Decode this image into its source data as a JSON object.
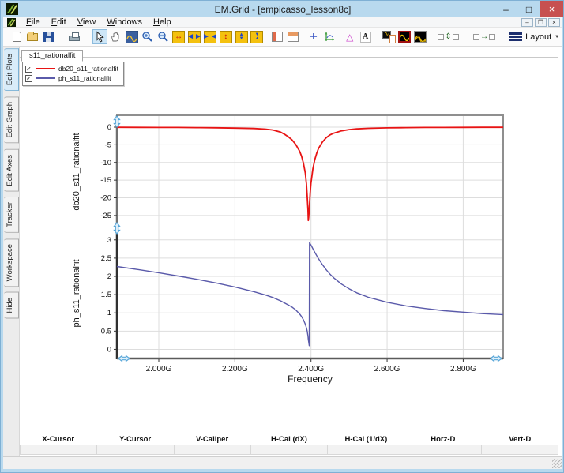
{
  "window": {
    "title": "EM.Grid - [empicasso_lesson8c]",
    "controls": {
      "minimize": "–",
      "maximize": "□",
      "close": "×",
      "mdi_minimize": "–",
      "mdi_restore": "❐",
      "mdi_close": "×"
    }
  },
  "menu": {
    "items": [
      "File",
      "Edit",
      "View",
      "Windows",
      "Help"
    ]
  },
  "toolbar": {
    "layout_label": "Layout",
    "text_tool_label": "A",
    "triangle_tool_glyph": "△",
    "plus_tool_glyph": "+"
  },
  "document_tab": {
    "label": "s11_rationalfit"
  },
  "sidebar": {
    "tabs": [
      "Edit Plots",
      "Edit Graph",
      "Edit Axes",
      "Tracker",
      "Workspace",
      "Hide"
    ],
    "active_tab": "Edit Plots"
  },
  "legend": {
    "items": [
      {
        "label": "db20_s11_rationalfit",
        "color": "#e81414",
        "checked": true
      },
      {
        "label": "ph_s11_rationalfit",
        "color": "#5a5aaa",
        "checked": true
      }
    ]
  },
  "chart_data": {
    "type": "line",
    "x_axis": {
      "label": "Frequency",
      "range": [
        1.89,
        2.905
      ],
      "ticks": [
        2.0,
        2.2,
        2.4,
        2.6,
        2.8
      ],
      "tick_labels": [
        "2.000G",
        "2.200G",
        "2.400G",
        "2.600G",
        "2.800G"
      ]
    },
    "top_axis": {
      "label": "db20_s11_rationalfit",
      "range": [
        -28.6,
        3.35
      ],
      "ticks": [
        0,
        -5,
        -10,
        -15,
        -20,
        -25
      ]
    },
    "bottom_axis": {
      "label": "ph_s11_rationalfit",
      "range": [
        -0.25,
        3.32
      ],
      "ticks": [
        3,
        2.5,
        2,
        1.5,
        1,
        0.5,
        0
      ]
    },
    "grid": true,
    "legend_position": "top-left",
    "series": [
      {
        "name": "db20_s11_rationalfit",
        "color": "#e81414",
        "axis": "top",
        "points": [
          [
            1.89,
            -0.05
          ],
          [
            1.95,
            -0.06
          ],
          [
            2.0,
            -0.08
          ],
          [
            2.05,
            -0.1
          ],
          [
            2.1,
            -0.13
          ],
          [
            2.15,
            -0.18
          ],
          [
            2.2,
            -0.26
          ],
          [
            2.25,
            -0.38
          ],
          [
            2.28,
            -0.55
          ],
          [
            2.3,
            -0.8
          ],
          [
            2.32,
            -1.4
          ],
          [
            2.33,
            -2.0
          ],
          [
            2.34,
            -2.7
          ],
          [
            2.35,
            -3.6
          ],
          [
            2.36,
            -4.9
          ],
          [
            2.37,
            -6.8
          ],
          [
            2.375,
            -8.2
          ],
          [
            2.38,
            -10.2
          ],
          [
            2.385,
            -13.0
          ],
          [
            2.388,
            -16.0
          ],
          [
            2.39,
            -19.5
          ],
          [
            2.392,
            -23.5
          ],
          [
            2.393,
            -26.4
          ],
          [
            2.394,
            -25.5
          ],
          [
            2.396,
            -22.0
          ],
          [
            2.398,
            -18.5
          ],
          [
            2.4,
            -15.8
          ],
          [
            2.405,
            -11.8
          ],
          [
            2.41,
            -9.2
          ],
          [
            2.415,
            -7.4
          ],
          [
            2.42,
            -6.0
          ],
          [
            2.43,
            -4.2
          ],
          [
            2.44,
            -3.0
          ],
          [
            2.45,
            -2.2
          ],
          [
            2.46,
            -1.7
          ],
          [
            2.48,
            -1.05
          ],
          [
            2.5,
            -0.7
          ],
          [
            2.52,
            -0.5
          ],
          [
            2.55,
            -0.33
          ],
          [
            2.6,
            -0.2
          ],
          [
            2.65,
            -0.14
          ],
          [
            2.7,
            -0.1
          ],
          [
            2.75,
            -0.08
          ],
          [
            2.8,
            -0.06
          ],
          [
            2.85,
            -0.05
          ],
          [
            2.905,
            -0.04
          ]
        ]
      },
      {
        "name": "ph_s11_rationalfit",
        "color": "#5a5aaa",
        "axis": "bottom",
        "points": [
          [
            1.89,
            2.27
          ],
          [
            1.95,
            2.18
          ],
          [
            2.0,
            2.1
          ],
          [
            2.05,
            2.01
          ],
          [
            2.1,
            1.92
          ],
          [
            2.15,
            1.82
          ],
          [
            2.2,
            1.71
          ],
          [
            2.25,
            1.58
          ],
          [
            2.28,
            1.49
          ],
          [
            2.3,
            1.42
          ],
          [
            2.32,
            1.33
          ],
          [
            2.34,
            1.22
          ],
          [
            2.35,
            1.16
          ],
          [
            2.36,
            1.08
          ],
          [
            2.37,
            0.97
          ],
          [
            2.375,
            0.9
          ],
          [
            2.38,
            0.81
          ],
          [
            2.385,
            0.69
          ],
          [
            2.388,
            0.59
          ],
          [
            2.39,
            0.5
          ],
          [
            2.392,
            0.36
          ],
          [
            2.393,
            0.27
          ],
          [
            2.394,
            0.2
          ],
          [
            2.3955,
            0.1
          ],
          [
            2.396,
            2.92
          ],
          [
            2.398,
            2.89
          ],
          [
            2.4,
            2.86
          ],
          [
            2.405,
            2.76
          ],
          [
            2.41,
            2.66
          ],
          [
            2.415,
            2.57
          ],
          [
            2.42,
            2.48
          ],
          [
            2.43,
            2.32
          ],
          [
            2.44,
            2.18
          ],
          [
            2.45,
            2.06
          ],
          [
            2.46,
            1.96
          ],
          [
            2.48,
            1.79
          ],
          [
            2.5,
            1.66
          ],
          [
            2.52,
            1.55
          ],
          [
            2.55,
            1.43
          ],
          [
            2.6,
            1.29
          ],
          [
            2.65,
            1.19
          ],
          [
            2.7,
            1.12
          ],
          [
            2.75,
            1.06
          ],
          [
            2.8,
            1.02
          ],
          [
            2.85,
            0.98
          ],
          [
            2.905,
            0.95
          ]
        ]
      }
    ]
  },
  "cursor_table": {
    "headers": [
      "X-Cursor",
      "Y-Cursor",
      "V-Caliper",
      "H-Cal (dX)",
      "H-Cal (1/dX)",
      "Horz-D",
      "Vert-D"
    ],
    "values": [
      "",
      "",
      "",
      "",
      "",
      "",
      ""
    ]
  },
  "colors": {
    "titlebar": "#b8d9ee",
    "close_button": "#c75050",
    "toolbar_selected": "#cde6f7",
    "grid_line": "#dddddd",
    "plot_border": "#8f8f8f",
    "axis_handle": "#58a6d8"
  }
}
